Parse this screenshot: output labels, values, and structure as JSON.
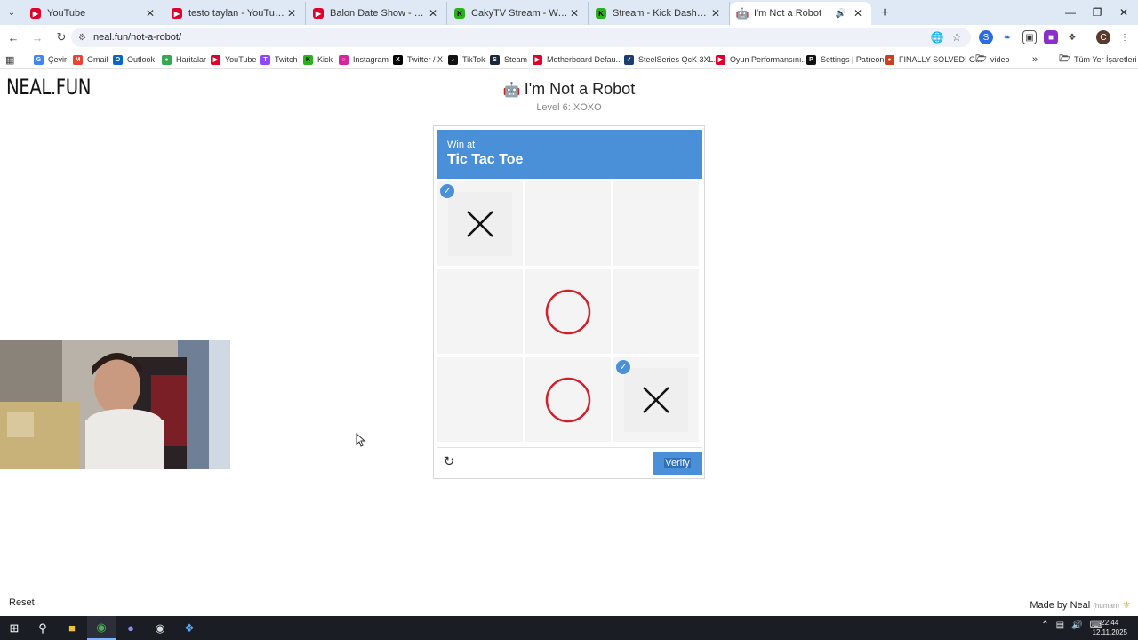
{
  "browser": {
    "tabs": [
      {
        "title": "YouTube",
        "icon": "youtube-icon"
      },
      {
        "title": "testo taylan - YouTube",
        "icon": "youtube-icon"
      },
      {
        "title": "Balon Date Show - YouTube",
        "icon": "youtube-icon"
      },
      {
        "title": "CakyTV Stream - Watch Live on",
        "icon": "kick-icon"
      },
      {
        "title": "Stream - Kick Dashboard",
        "icon": "kick-icon"
      },
      {
        "title": "I'm Not a Robot",
        "icon": "robot-icon"
      }
    ],
    "active_tab": 5,
    "url": "neal.fun/not-a-robot/",
    "profile_initial": "C",
    "bookmarks": [
      "Çevir",
      "Gmail",
      "Outlook",
      "Haritalar",
      "YouTube",
      "Twitch",
      "Kick",
      "Instagram",
      "Twitter / X",
      "TikTok",
      "Steam",
      "Motherboard Defau...",
      "SteelSeries QcK 3XL...",
      "Oyun Performansını...",
      "Settings | Patreon",
      "FINALLY SOLVED! G...",
      "video"
    ],
    "all_bookmarks": "Tüm Yer İşaretleri"
  },
  "page": {
    "logo": "NEAL.FUN",
    "title": "I'm Not a Robot",
    "level": "Level 6: XOXO",
    "reset": "Reset",
    "made_by": "Made by Neal",
    "made_by_tag": "(human)"
  },
  "captcha": {
    "header_small": "Win at",
    "header_big": "Tic Tac Toe",
    "board": [
      "X",
      "",
      "",
      "",
      "O",
      "",
      "",
      "O",
      "X"
    ],
    "selected": [
      0,
      8
    ],
    "verify_label": "Verify",
    "accent": "#4a90d9",
    "o_color": "#d21f2b"
  },
  "taskbar": {
    "time": "22:44",
    "date": "12.11.2025"
  }
}
